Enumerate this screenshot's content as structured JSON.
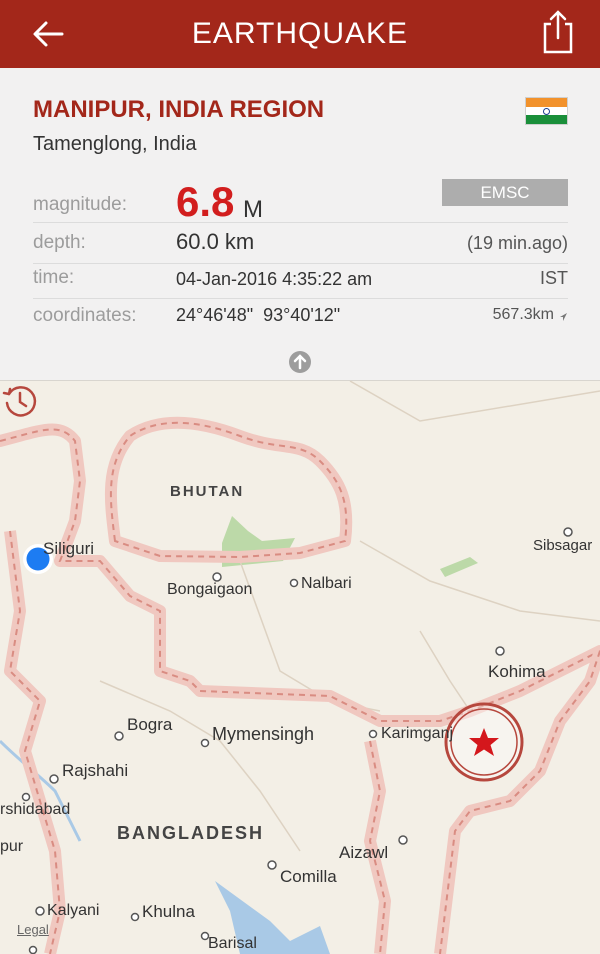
{
  "header": {
    "title": "EARTHQUAKE",
    "back_icon": "arrow-left-icon",
    "share_icon": "share-icon",
    "bg_color": "#a3271a"
  },
  "quake": {
    "region": "MANIPUR, INDIA REGION",
    "place": "Tamenglong, India",
    "flag_icon": "india-flag-icon",
    "magnitude_label": "magnitude:",
    "magnitude_value": "6.8",
    "magnitude_unit": "M",
    "source": "EMSC",
    "depth_label": "depth:",
    "depth_value": "60.0 km",
    "ago": "(19 min.ago)",
    "time_label": "time:",
    "time_value": "04-Jan-2016 4:35:22 am",
    "tz": "IST",
    "coords_label": "coordinates:",
    "coords_value": "24°46'48\"  93°40'12\"",
    "distance": "567.3km",
    "accent_color": "#d21e1e"
  },
  "map": {
    "labels": {
      "bhutan": "BHUTAN",
      "siliguri": "Siliguri",
      "sibsagar": "Sibsagar",
      "bongaigaon": "Bongaigaon",
      "nalbari": "Nalbari",
      "kohima": "Kohima",
      "bogra": "Bogra",
      "mymensingh": "Mymensingh",
      "karimganj": "Karimganj",
      "rajshahi": "Rajshahi",
      "murshidabad": "rshidabad",
      "bangladesh": "BANGLADESH",
      "aizawl": "Aizawl",
      "pur": "pur",
      "comilla": "Comilla",
      "kalyani": "Kalyani",
      "khulna": "Khulna",
      "barisal": "Barisal"
    },
    "legal": "Legal",
    "history_icon": "history-icon",
    "epicenter_icon": "epicenter-star-icon",
    "location_icon": "user-location-icon"
  }
}
